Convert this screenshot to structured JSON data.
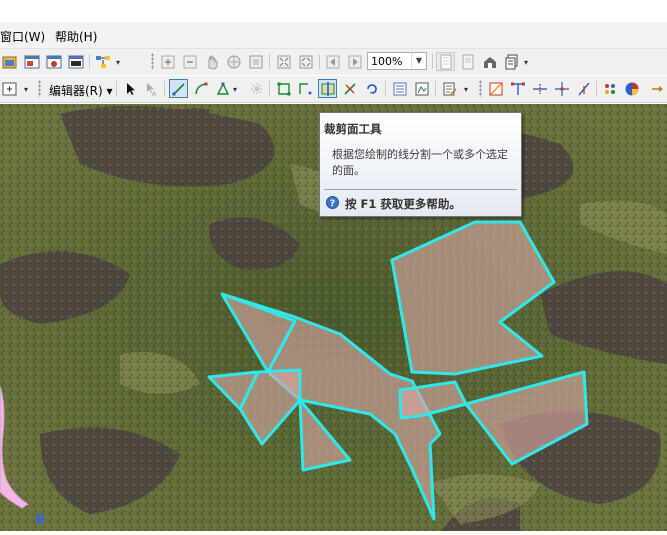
{
  "menubar": {
    "items": [
      {
        "label": "窗口(W)"
      },
      {
        "label": "帮助(H)"
      }
    ]
  },
  "toolbar_standard": {
    "zoom_value": "100%"
  },
  "toolbar_editor": {
    "editor_menu_label": "编辑器(R)"
  },
  "tooltip": {
    "title": "裁剪面工具",
    "description": "根据您绘制的线分割一个或多个选定的面。",
    "help": "按 F1 获取更多帮助。"
  },
  "map": {
    "polygon_outline_color": "#2ee8ec",
    "polygon_fill_color": "#d9a8a4",
    "boundary_line_color": "#f4b6e6"
  }
}
